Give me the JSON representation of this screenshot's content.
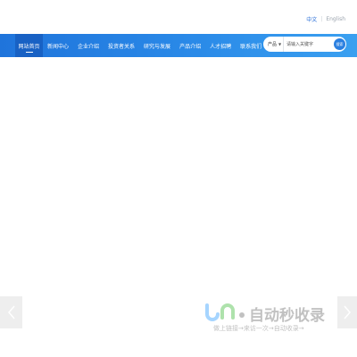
{
  "language": {
    "chinese": "中文",
    "separator": "|",
    "english": "English"
  },
  "nav": {
    "items": [
      {
        "label": "网站首页",
        "active": true
      },
      {
        "label": "新闻中心",
        "active": false
      },
      {
        "label": "企业介绍",
        "active": false
      },
      {
        "label": "投资者关系",
        "active": false
      },
      {
        "label": "研究与发展",
        "active": false
      },
      {
        "label": "产品介绍",
        "active": false
      },
      {
        "label": "人才招聘",
        "active": false
      },
      {
        "label": "联系我们",
        "active": false
      }
    ]
  },
  "search": {
    "type_label": "产品",
    "placeholder": "请输入关键字",
    "button_label": "搜索"
  },
  "slider": {
    "prev_icon": "chevron-left-icon",
    "next_icon": "chevron-right-icon"
  },
  "watermark": {
    "title": "自动秒收录",
    "subtitle": "做上链接→来访一次→自动收录→"
  },
  "colors": {
    "nav_start": "#1f74db",
    "nav_end": "#3aa0f0",
    "nav_active": "#1861c4",
    "accent": "#2a6fd8"
  }
}
